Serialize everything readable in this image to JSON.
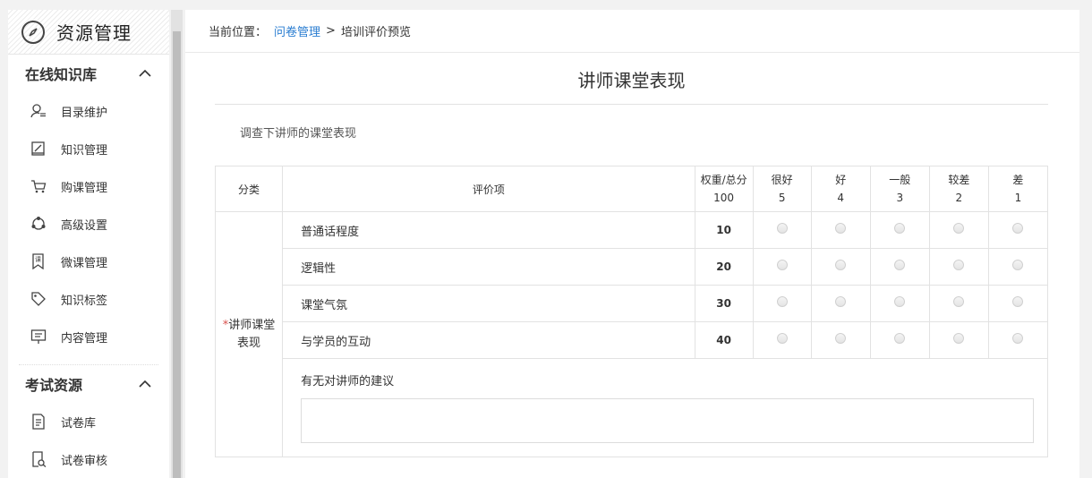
{
  "sidebar": {
    "title": "资源管理",
    "sections": [
      {
        "title": "在线知识库",
        "items": [
          {
            "label": "目录维护",
            "icon": "user-list-icon"
          },
          {
            "label": "知识管理",
            "icon": "edit-book-icon"
          },
          {
            "label": "购课管理",
            "icon": "cart-icon"
          },
          {
            "label": "高级设置",
            "icon": "share-nodes-icon"
          },
          {
            "label": "微课管理",
            "icon": "bookmark-course-icon"
          },
          {
            "label": "知识标签",
            "icon": "tag-icon"
          },
          {
            "label": "内容管理",
            "icon": "monitor-icon"
          }
        ]
      },
      {
        "title": "考试资源",
        "items": [
          {
            "label": "试卷库",
            "icon": "document-icon"
          },
          {
            "label": "试卷审核",
            "icon": "audit-icon"
          }
        ]
      }
    ]
  },
  "breadcrumb": {
    "prefix": "当前位置：",
    "link": "问卷管理",
    "separator": ">",
    "current": "培训评价预览"
  },
  "form": {
    "title": "讲师课堂表现",
    "description": "调查下讲师的课堂表现",
    "headers": {
      "category": "分类",
      "item": "评价项",
      "weight_label": "权重/总分",
      "weight_total": "100",
      "levels": [
        {
          "label": "很好",
          "score": "5"
        },
        {
          "label": "好",
          "score": "4"
        },
        {
          "label": "一般",
          "score": "3"
        },
        {
          "label": "较差",
          "score": "2"
        },
        {
          "label": "差",
          "score": "1"
        }
      ]
    },
    "category": {
      "required_mark": "*",
      "line1": "讲师课堂",
      "line2": "表现"
    },
    "rows": [
      {
        "item": "普通话程度",
        "weight": "10"
      },
      {
        "item": "逻辑性",
        "weight": "20"
      },
      {
        "item": "课堂气氛",
        "weight": "30"
      },
      {
        "item": "与学员的互动",
        "weight": "40"
      }
    ],
    "suggestion_label": "有无对讲师的建议",
    "suggestion_value": ""
  }
}
